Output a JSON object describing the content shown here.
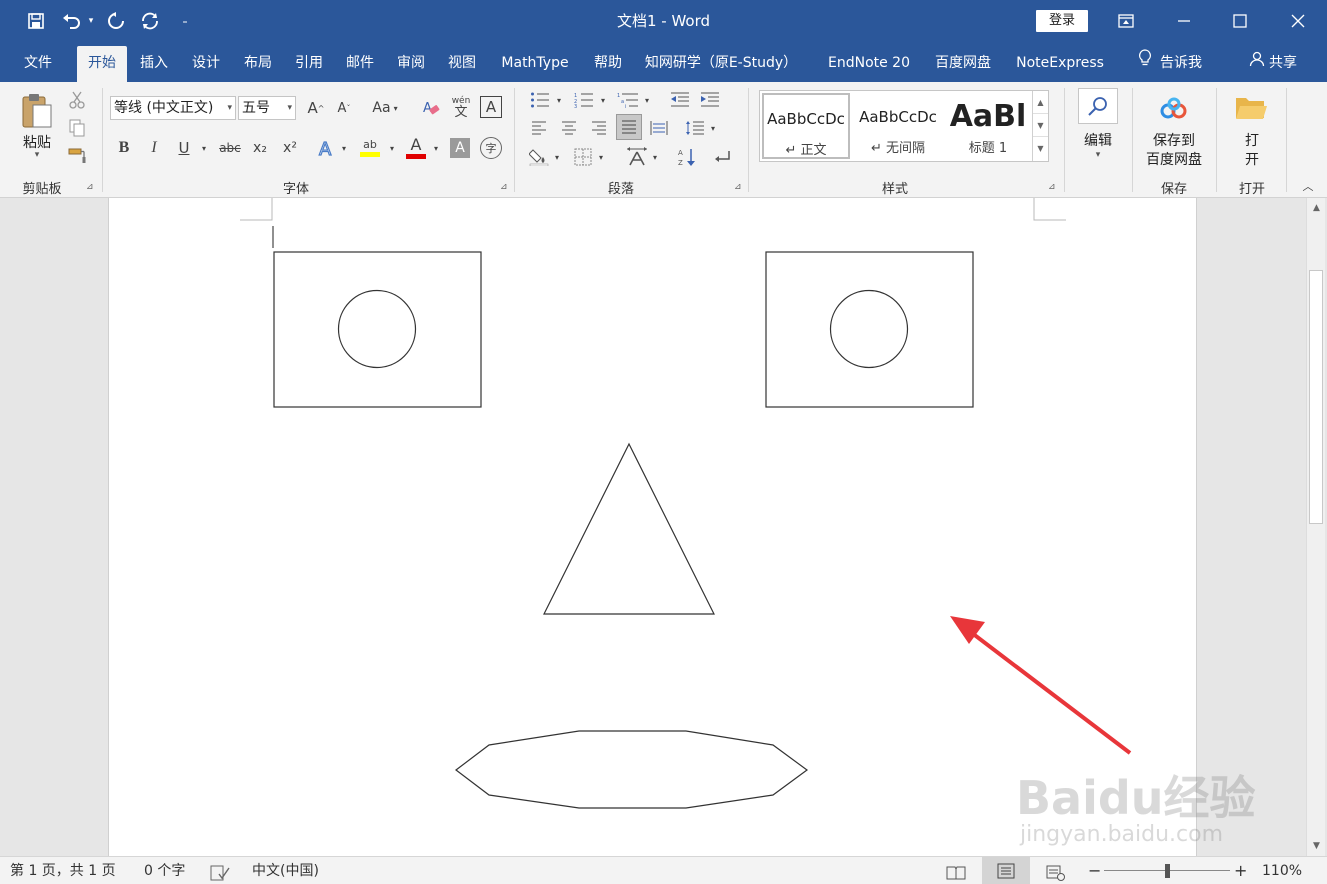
{
  "titlebar": {
    "title": "文档1  -  Word",
    "login_label": "登录"
  },
  "tabs": [
    {
      "label": "文件"
    },
    {
      "label": "开始"
    },
    {
      "label": "插入"
    },
    {
      "label": "设计"
    },
    {
      "label": "布局"
    },
    {
      "label": "引用"
    },
    {
      "label": "邮件"
    },
    {
      "label": "审阅"
    },
    {
      "label": "视图"
    },
    {
      "label": "MathType"
    },
    {
      "label": "帮助"
    },
    {
      "label": "知网研学（原E-Study）"
    },
    {
      "label": "EndNote 20"
    },
    {
      "label": "百度网盘"
    },
    {
      "label": "NoteExpress"
    },
    {
      "label": "告诉我"
    },
    {
      "label": "共享"
    }
  ],
  "ribbon": {
    "clipboard": {
      "paste_label": "粘贴",
      "group_label": "剪贴板"
    },
    "font": {
      "font_name": "等线 (中文正文)",
      "font_size": "五号",
      "case_label": "Aa",
      "phonetic_label": "wén",
      "phonetic_char": "文",
      "border_char": "A",
      "bold": "B",
      "italic": "I",
      "underline": "U",
      "strike": "abc",
      "sub": "x₂",
      "sup": "x²",
      "highlight_char": "ab",
      "fontcolor_char": "A",
      "shade_char": "A",
      "grow_char": "A",
      "shrink_char": "A",
      "encircle_char": "字",
      "group_label": "字体"
    },
    "paragraph": {
      "group_label": "段落"
    },
    "styles": {
      "items": [
        {
          "sample": "AaBbCcDc",
          "name": "↵ 正文"
        },
        {
          "sample": "AaBbCcDc",
          "name": "↵ 无间隔"
        },
        {
          "sample": "AaBl",
          "name": "标题 1"
        }
      ],
      "group_label": "样式"
    },
    "editing": {
      "label": "编辑"
    },
    "baidu": {
      "label_line1": "保存到",
      "label_line2": "百度网盘",
      "group_label": "保存"
    },
    "open": {
      "label_line1": "打",
      "label_line2": "开",
      "group_label": "打开"
    }
  },
  "statusbar": {
    "page_info": "第 1 页，共 1 页",
    "word_count": "0 个字",
    "language": "中文(中国)",
    "zoom": "110%",
    "zoom_minus": "−",
    "zoom_plus": "+"
  },
  "colors": {
    "brand": "#2b579a",
    "arrow": "#e8363a",
    "highlight_bar": "#ffff00",
    "fontcolor_bar": "#e00000"
  },
  "watermark": {
    "brand": "Baidu经验",
    "url": "jingyan.baidu.com"
  }
}
